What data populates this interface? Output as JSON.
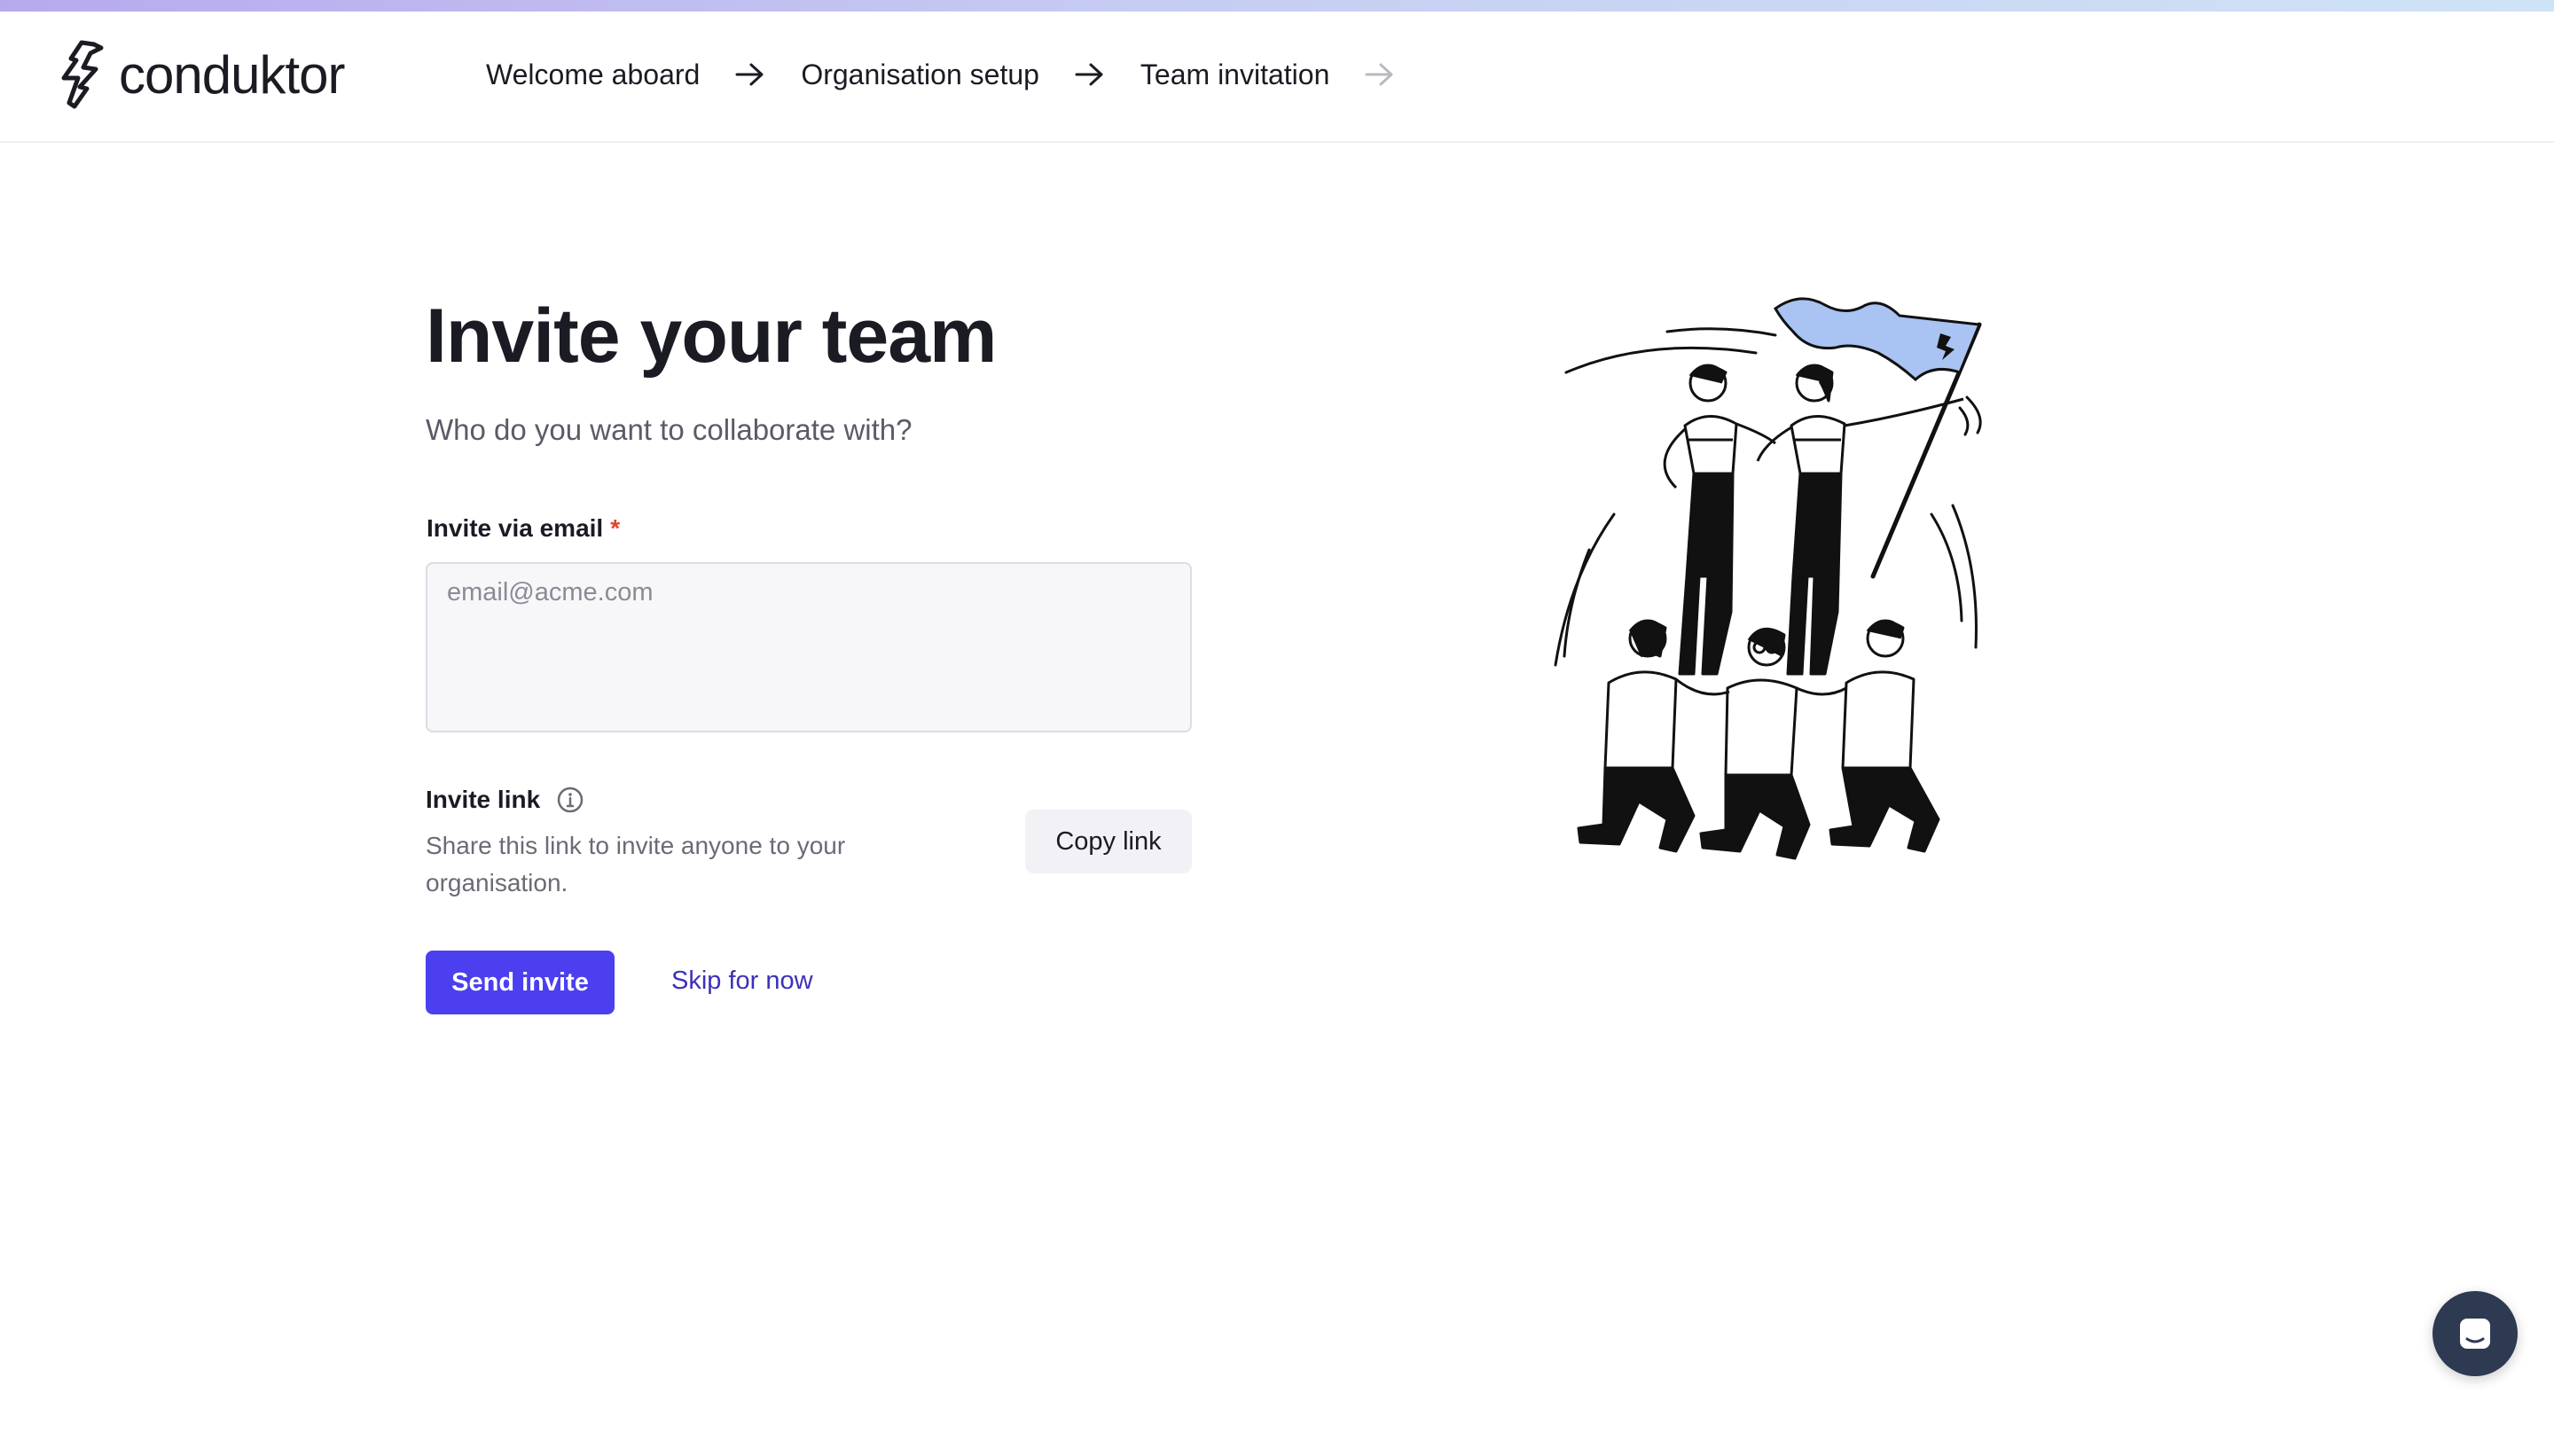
{
  "header": {
    "brand": "conduktor",
    "breadcrumb": [
      "Welcome aboard",
      "Organisation setup",
      "Team invitation"
    ]
  },
  "main": {
    "title": "Invite your team",
    "subtitle": "Who do you want to collaborate with?",
    "email_label": "Invite via email",
    "required_mark": "*",
    "email_placeholder": "email@acme.com",
    "email_value": "",
    "invite_link_label": "Invite link",
    "invite_link_desc": "Share this link to invite anyone to your organisation.",
    "copy_link": "Copy link",
    "send_invite": "Send invite",
    "skip": "Skip for now"
  },
  "colors": {
    "primary": "#4b3ff0",
    "link": "#3b31b8",
    "required": "#e0442b",
    "chat_bg": "#2d3a52",
    "flag": "#a9c3f2"
  },
  "icons": [
    "conduktor-logo-icon",
    "arrow-right-icon",
    "info-icon",
    "chat-icon",
    "team-illustration"
  ]
}
